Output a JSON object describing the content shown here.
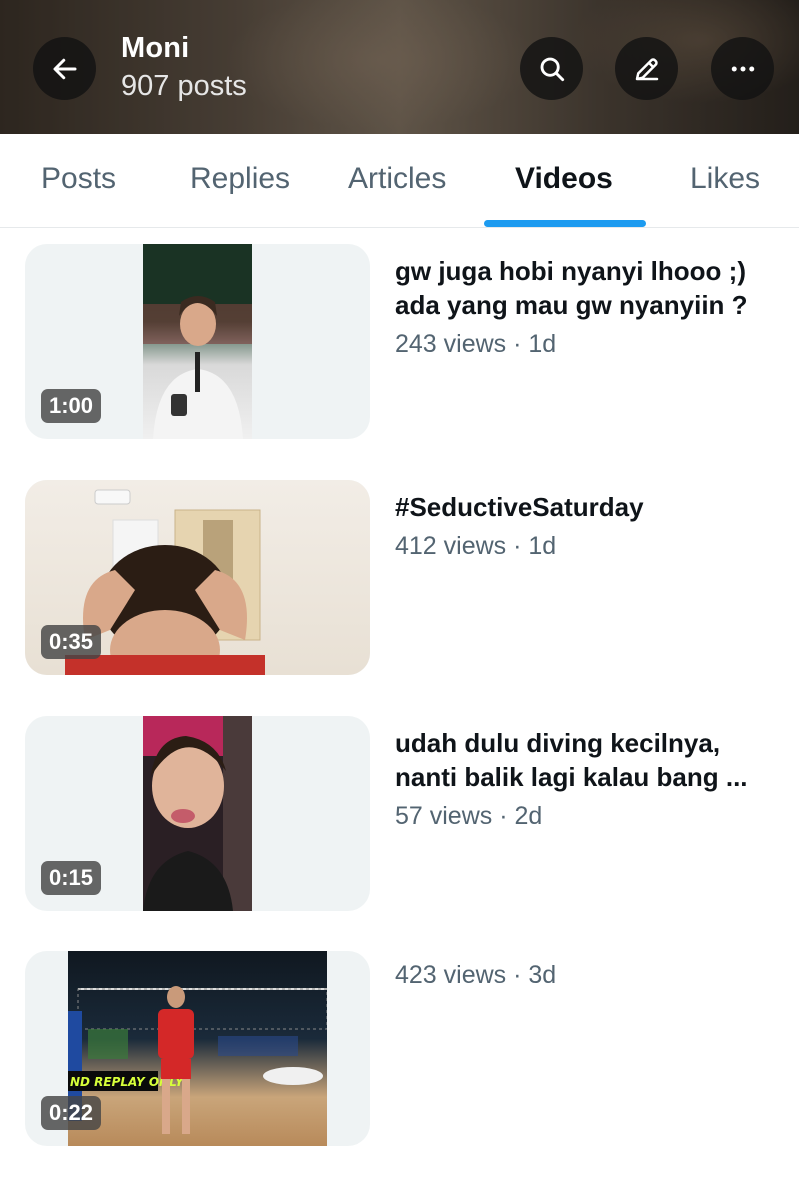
{
  "header": {
    "profile_name": "Moni",
    "post_count": "907 posts",
    "icons": [
      "back-arrow-icon",
      "search-icon",
      "edit-icon",
      "more-icon"
    ]
  },
  "tabs": [
    {
      "label": "Posts",
      "active": false
    },
    {
      "label": "Replies",
      "active": false
    },
    {
      "label": "Articles",
      "active": false
    },
    {
      "label": "Videos",
      "active": true
    },
    {
      "label": "Likes",
      "active": false
    }
  ],
  "colors": {
    "accent": "#1d9bf0",
    "text_primary": "#0f1419",
    "text_secondary": "#536471",
    "thumb_bg": "#eff3f4"
  },
  "videos": [
    {
      "duration": "1:00",
      "title": "gw juga hobi nyanyi lhooo ;)\nada yang mau gw nyanyiin ?",
      "meta": "243 views · 1d"
    },
    {
      "duration": "0:35",
      "title": "#SeductiveSaturday",
      "meta": "412 views · 1d"
    },
    {
      "duration": "0:15",
      "title": "udah dulu diving kecilnya,\nnanti balik lagi kalau bang ...",
      "meta": "57 views · 2d"
    },
    {
      "duration": "0:22",
      "title": "",
      "meta": "423 views · 3d",
      "thumb_text": "ND REPLAY ONLY"
    }
  ]
}
